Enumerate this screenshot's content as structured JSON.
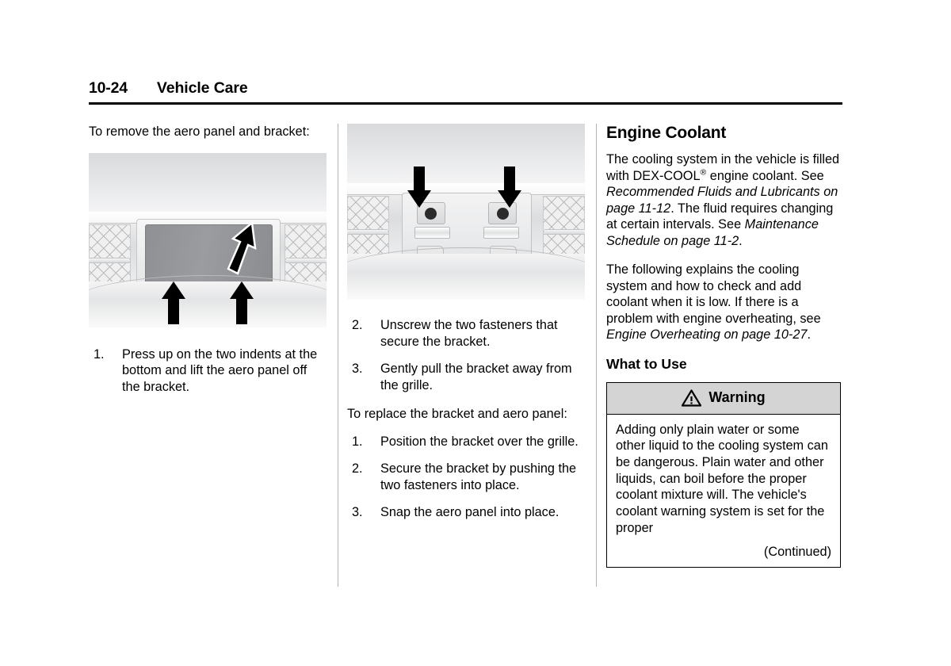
{
  "header": {
    "page_number": "10-24",
    "section_title": "Vehicle Care"
  },
  "left_column": {
    "intro": "To remove the aero panel and bracket:",
    "figure": {
      "name": "aero-panel-removal-illustration",
      "description": "Front vehicle grille with aero panel, two upward arrows at the bottom indents and a diagonal arrow lifting the panel"
    },
    "steps": [
      {
        "num": "1.",
        "text": "Press up on the two indents at the bottom and lift the aero panel off the bracket."
      }
    ]
  },
  "middle_column": {
    "figure": {
      "name": "bracket-fasteners-illustration",
      "description": "Grille bracket with two fasteners, two downward arrows pointing at the fasteners"
    },
    "steps": [
      {
        "num": "2.",
        "text": "Unscrew the two fasteners that secure the bracket."
      },
      {
        "num": "3.",
        "text": "Gently pull the bracket away from the grille."
      }
    ],
    "replace_intro": "To replace the bracket and aero panel:",
    "replace_steps": [
      {
        "num": "1.",
        "text": "Position the bracket over the grille."
      },
      {
        "num": "2.",
        "text": "Secure the bracket by pushing the two fasteners into place."
      },
      {
        "num": "3.",
        "text": "Snap the aero panel into place."
      }
    ]
  },
  "right_column": {
    "heading": "Engine Coolant",
    "para1": {
      "part1": "The cooling system in the vehicle is filled with DEX-COOL",
      "registered": "®",
      "part2": " engine coolant. See ",
      "ref1": "Recommended Fluids and Lubricants on page 11-12",
      "part3": ". The fluid requires changing at certain intervals. See ",
      "ref2": "Maintenance Schedule on page 11-2",
      "part4": "."
    },
    "para2": {
      "part1": "The following explains the cooling system and how to check and add coolant when it is low. If there is a problem with engine overheating, see ",
      "ref1": "Engine Overheating on page 10-27",
      "part2": "."
    },
    "subheading": "What to Use",
    "warning": {
      "label": "Warning",
      "icon": "warning-triangle-icon",
      "body": "Adding only plain water or some other liquid to the cooling system can be dangerous. Plain water and other liquids, can boil before the proper coolant mixture will. The vehicle's coolant warning system is set for the proper",
      "continued": "(Continued)",
      "header_bg": "#d4d4d4",
      "border_color": "#000000"
    }
  }
}
